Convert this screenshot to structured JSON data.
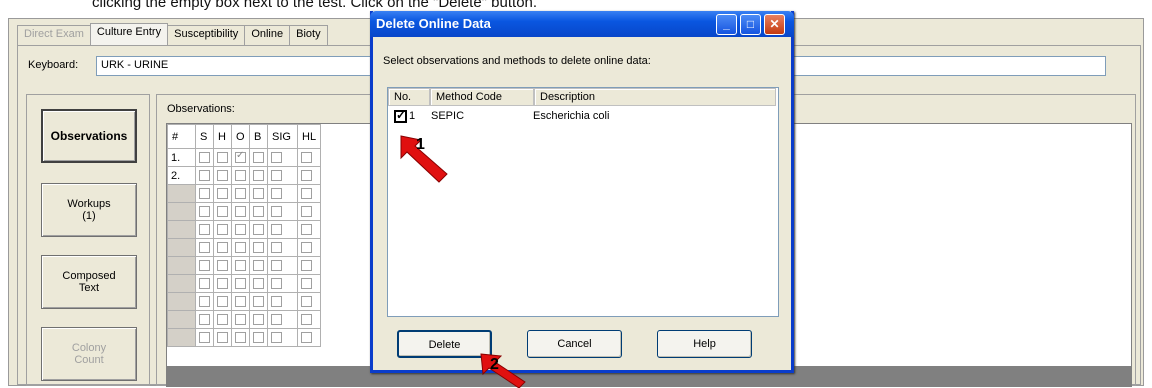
{
  "instruction": "clicking the empty box next to the test. Click on the \"Delete\" button.",
  "tabs": [
    {
      "label": "Direct Exam",
      "state": "disabled"
    },
    {
      "label": "Culture Entry",
      "state": "active"
    },
    {
      "label": "Susceptibility",
      "state": "normal"
    },
    {
      "label": "Online",
      "state": "normal"
    },
    {
      "label": "Bioty",
      "state": "normal"
    }
  ],
  "keyboard": {
    "label": "Keyboard:",
    "value": "URK - URINE"
  },
  "side_buttons": [
    {
      "label": "Observations",
      "bold": true,
      "disabled": false
    },
    {
      "label": "Workups\n(1)",
      "bold": false,
      "disabled": false
    },
    {
      "label": "Composed\nText",
      "bold": false,
      "disabled": false
    },
    {
      "label": "Colony\nCount",
      "bold": false,
      "disabled": true
    }
  ],
  "observations": {
    "label": "Observations:",
    "headers": [
      "#",
      "S",
      "H",
      "O",
      "B",
      "SIG",
      "HL"
    ],
    "rows": [
      {
        "num": "1.",
        "checked": [
          false,
          false,
          true,
          false,
          false,
          false
        ]
      },
      {
        "num": "2.",
        "checked": [
          false,
          false,
          false,
          false,
          false,
          false
        ]
      },
      {
        "num": "",
        "checked": [
          false,
          false,
          false,
          false,
          false,
          false
        ]
      },
      {
        "num": "",
        "checked": [
          false,
          false,
          false,
          false,
          false,
          false
        ]
      },
      {
        "num": "",
        "checked": [
          false,
          false,
          false,
          false,
          false,
          false
        ]
      },
      {
        "num": "",
        "checked": [
          false,
          false,
          false,
          false,
          false,
          false
        ]
      },
      {
        "num": "",
        "checked": [
          false,
          false,
          false,
          false,
          false,
          false
        ]
      },
      {
        "num": "",
        "checked": [
          false,
          false,
          false,
          false,
          false,
          false
        ]
      },
      {
        "num": "",
        "checked": [
          false,
          false,
          false,
          false,
          false,
          false
        ]
      },
      {
        "num": "",
        "checked": [
          false,
          false,
          false,
          false,
          false,
          false
        ]
      },
      {
        "num": "",
        "checked": [
          false,
          false,
          false,
          false,
          false,
          false
        ]
      }
    ]
  },
  "dialog": {
    "title": "Delete Online Data",
    "instruction": "Select observations and methods to delete online data:",
    "columns": [
      "No.",
      "Method Code",
      "Description"
    ],
    "rows": [
      {
        "no": "1",
        "method_code": "SEPIC",
        "description": "Escherichia coli",
        "checked": true
      }
    ],
    "buttons": {
      "delete": "Delete",
      "cancel": "Cancel",
      "help": "Help"
    }
  },
  "callouts": {
    "one": "1",
    "two": "2"
  },
  "colors": {
    "title_bar": "#0a56e0",
    "arrow": "#e01010",
    "panel": "#ece9d8"
  }
}
